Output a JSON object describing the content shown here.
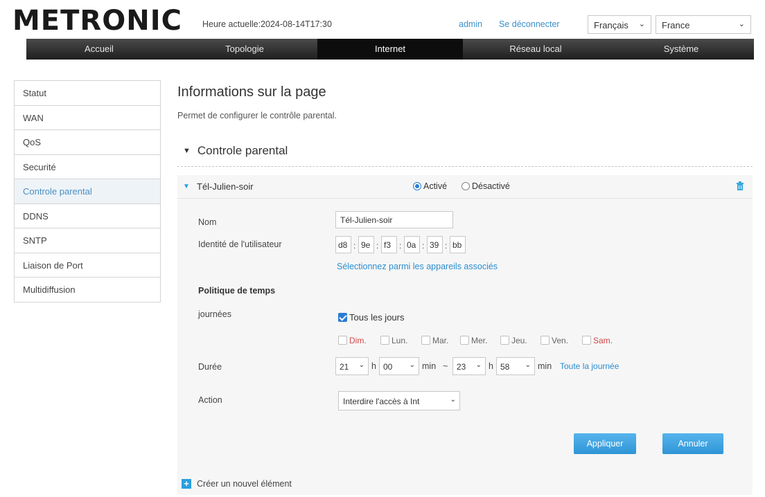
{
  "header": {
    "logo": "METRONIC",
    "clock_label": "Heure actuelle:",
    "clock_value": "2024-08-14T17:30",
    "user": "admin",
    "logout": "Se déconnecter",
    "language": "Français",
    "country": "France"
  },
  "nav": {
    "tabs": [
      {
        "label": "Accueil"
      },
      {
        "label": "Topologie"
      },
      {
        "label": "Internet"
      },
      {
        "label": "Réseau local"
      },
      {
        "label": "Système"
      }
    ],
    "active": "Internet"
  },
  "sidebar": {
    "items": [
      {
        "label": "Statut"
      },
      {
        "label": "WAN"
      },
      {
        "label": "QoS"
      },
      {
        "label": "Securité"
      },
      {
        "label": "Controle parental"
      },
      {
        "label": "DDNS"
      },
      {
        "label": "SNTP"
      },
      {
        "label": "Liaison de Port"
      },
      {
        "label": "Multidiffusion"
      }
    ],
    "active": "Controle parental"
  },
  "main": {
    "title": "Informations sur la page",
    "description": "Permet de configurer le contrôle parental.",
    "section_title": "Controle parental"
  },
  "rule": {
    "name": "Tél-Julien-soir",
    "status_active": "Activé",
    "status_inactive": "Désactivé",
    "status_selected": "Activé",
    "labels": {
      "name": "Nom",
      "user_id": "Identité de l'utilisateur",
      "time_policy": "Politique de temps",
      "days": "journées",
      "duration": "Durée",
      "action": "Action"
    },
    "name_value": "Tél-Julien-soir",
    "mac": [
      "d8",
      "9e",
      "f3",
      "0a",
      "39",
      "bb"
    ],
    "select_devices": "Sélectionnez parmi les appareils associés",
    "every_day_label": "Tous les jours",
    "every_day_checked": true,
    "days": [
      "Dim.",
      "Lun.",
      "Mar.",
      "Mer.",
      "Jeu.",
      "Ven.",
      "Sam."
    ],
    "duration": {
      "start_hour": "21",
      "start_min": "00",
      "end_hour": "23",
      "end_min": "58",
      "h_unit": "h",
      "min_unit": "min",
      "separator": "~",
      "all_day": "Toute la journée"
    },
    "action_value": "Interdire l'accès à Int",
    "apply": "Appliquer",
    "cancel": "Annuler"
  },
  "footer": {
    "create": "Créer un nouvel élément"
  }
}
